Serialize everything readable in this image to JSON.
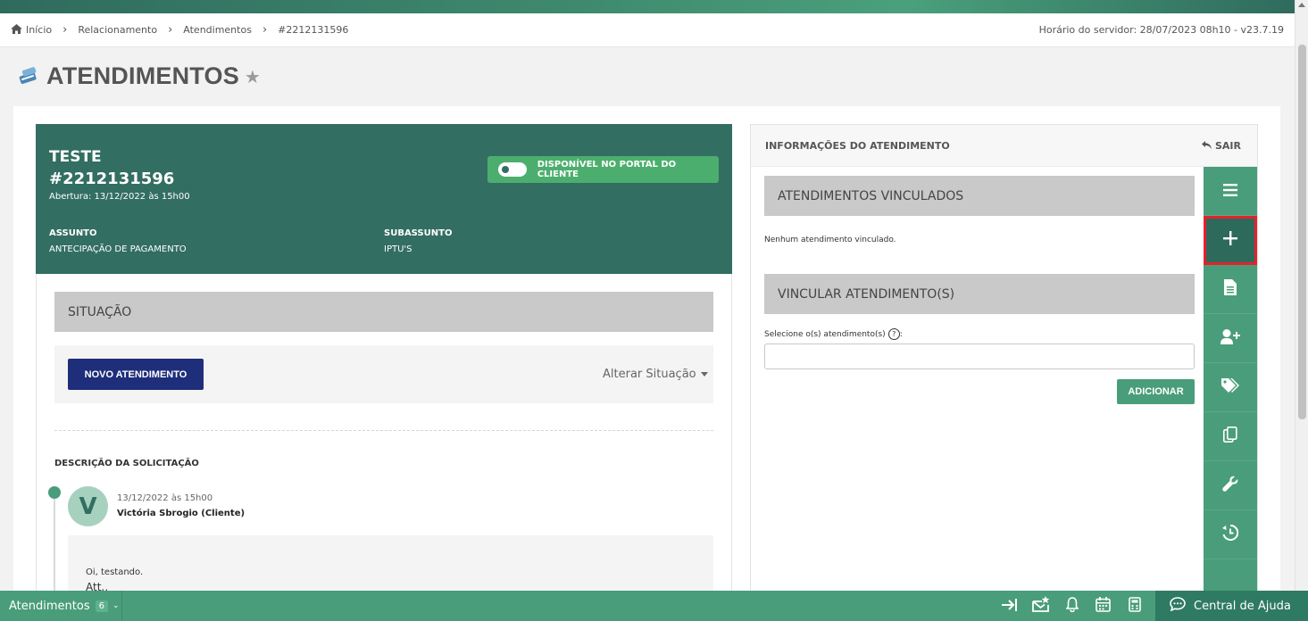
{
  "breadcrumb": {
    "items": [
      "Início",
      "Relacionamento",
      "Atendimentos",
      "#2212131596"
    ],
    "server_time": "Horário do servidor: 28/07/2023 08h10 - v23.7.19"
  },
  "page": {
    "title": "ATENDIMENTOS"
  },
  "ticket": {
    "name": "TESTE",
    "number": "#2212131596",
    "opened": "Abertura: 13/12/2022 às 15h00",
    "portal_toggle_label": "DISPONÍVEL NO PORTAL DO CLIENTE",
    "subject_label": "ASSUNTO",
    "subject_value": "ANTECIPAÇÃO DE PAGAMENTO",
    "subsubject_label": "SUBASSUNTO",
    "subsubject_value": "IPTU'S",
    "situation_header": "SITUAÇÃO",
    "new_button": "NOVO ATENDIMENTO",
    "alter_status": "Alterar Situação",
    "description_title": "DESCRIÇÃO DA SOLICITAÇÃO",
    "message": {
      "avatar_letter": "V",
      "date": "13/12/2022 às 15h00",
      "author": "Victória Sbrogio (Cliente)",
      "line1": "Oi, testando.",
      "line2": "Att.,"
    }
  },
  "info": {
    "title": "INFORMAÇÕES DO ATENDIMENTO",
    "exit": "SAIR",
    "linked_header": "ATENDIMENTOS VINCULADOS",
    "no_linked": "Nenhum atendimento vinculado.",
    "link_header": "VINCULAR ATENDIMENTO(S)",
    "select_label": "Selecione o(s) atendimento(s)",
    "select_value": "",
    "add_button": "ADICIONAR"
  },
  "side_rail": {
    "icons": [
      "menu-icon",
      "plus-icon",
      "document-icon",
      "user-plus-icon",
      "tags-icon",
      "copy-icon",
      "wrench-icon",
      "history-icon"
    ],
    "active_index": 1
  },
  "footer": {
    "tab_label": "Atendimentos",
    "tab_count": "6",
    "help_center": "Central de Ajuda"
  },
  "colors": {
    "primary_dark": "#336e62",
    "primary": "#4a9d7a",
    "navy_button": "#1f2e7a",
    "highlight": "#e8202a"
  }
}
